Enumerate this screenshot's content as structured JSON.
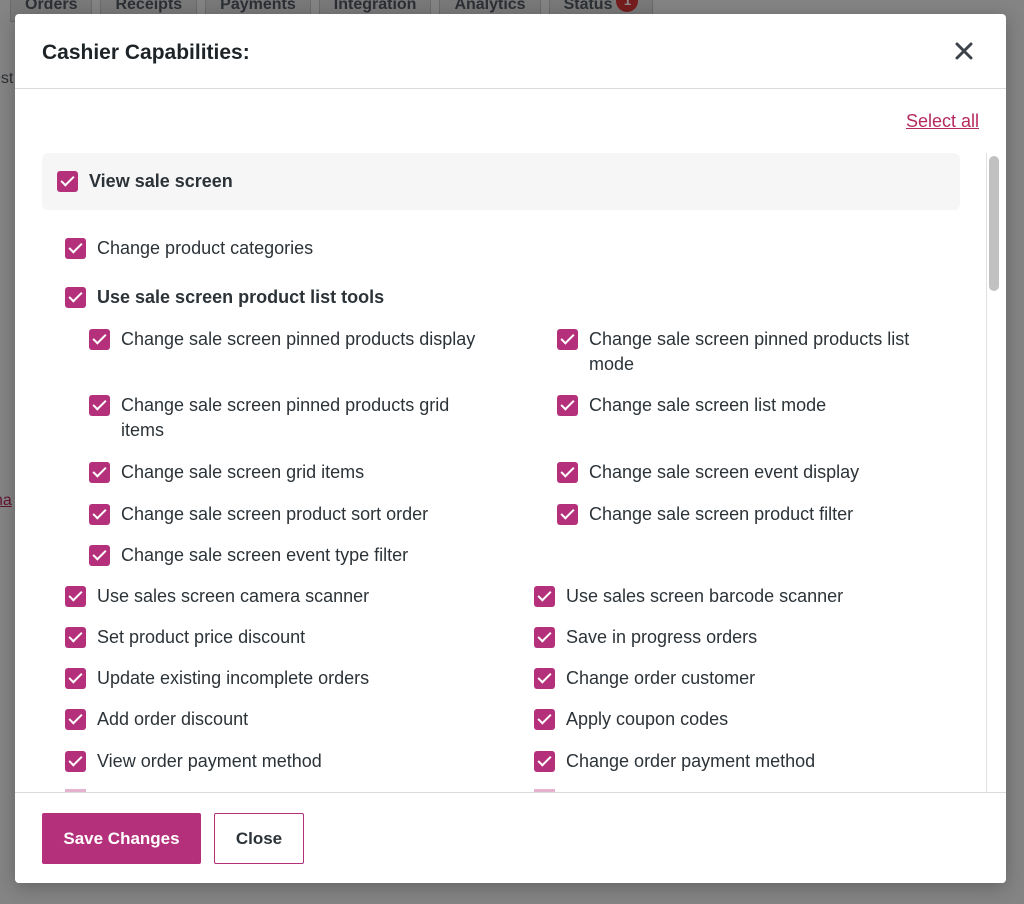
{
  "background": {
    "tabs": [
      {
        "label": "Orders"
      },
      {
        "label": "Receipts"
      },
      {
        "label": "Payments"
      },
      {
        "label": "Integration"
      },
      {
        "label": "Analytics"
      },
      {
        "label": "Status",
        "badge": "1"
      }
    ],
    "fragment_text": "est",
    "fragment_link": "na"
  },
  "modal": {
    "title": "Cashier Capabilities:",
    "close_icon": "close-icon",
    "select_all": "Select all",
    "group_label": "View sale screen",
    "items": [
      "Change product categories",
      "Use sale screen product list tools",
      "Change sale screen pinned products display",
      "Change sale screen pinned products list mode",
      "Change sale screen pinned products grid items",
      "Change sale screen list mode",
      "Change sale screen grid items",
      "Change sale screen event display",
      "Change sale screen product sort order",
      "Change sale screen product filter",
      "Change sale screen event type filter",
      "Use sales screen camera scanner",
      "Use sales screen barcode scanner",
      "Set product price discount",
      "Save in progress orders",
      "Update existing incomplete orders",
      "Change order customer",
      "Add order discount",
      "Apply coupon codes",
      "View order payment method",
      "Change order payment method"
    ],
    "checked": true,
    "save_button": "Save Changes",
    "close_button": "Close"
  },
  "colors": {
    "accent": "#b5307a",
    "link": "#b5295f",
    "overlay": "rgba(0,0,0,0.45)"
  }
}
